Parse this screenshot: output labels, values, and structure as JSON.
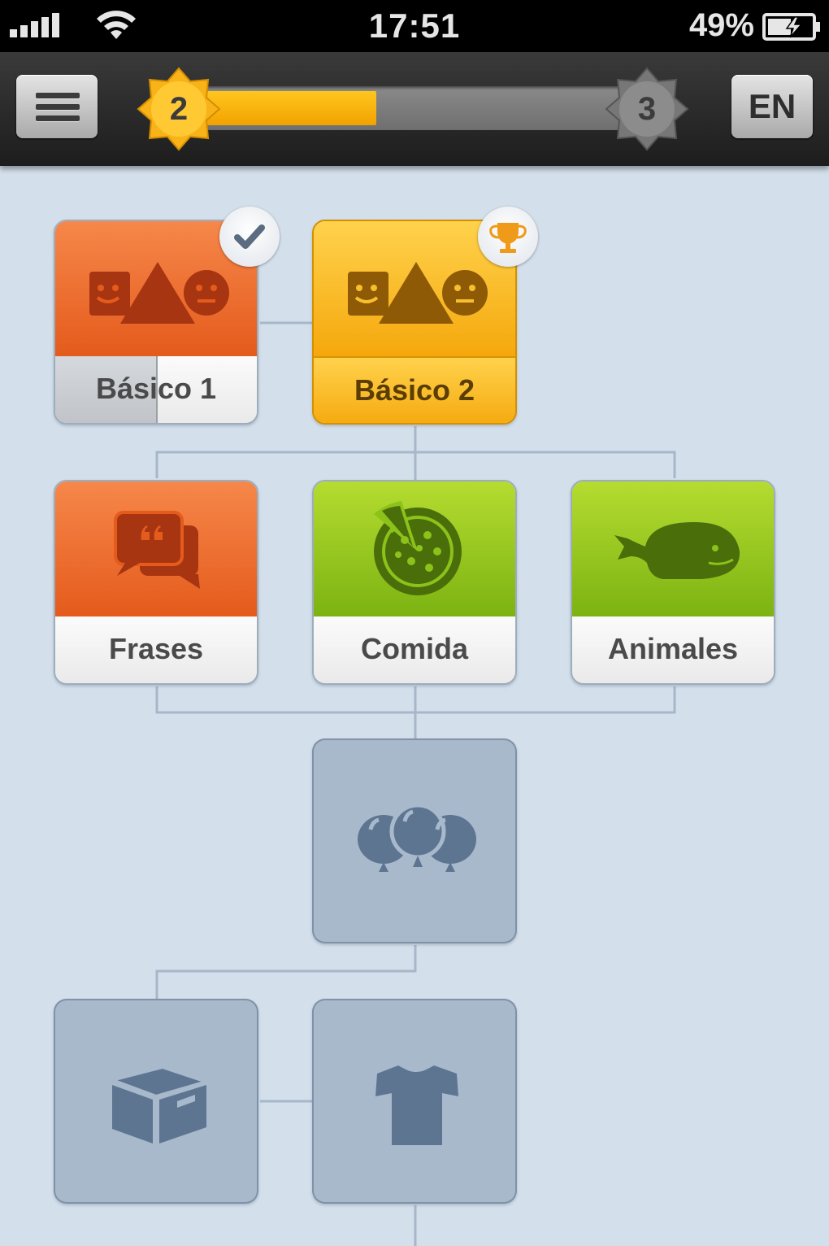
{
  "status_bar": {
    "time": "17:51",
    "battery": "49%",
    "icons": [
      "signal-icon",
      "wifi-icon",
      "battery-icon"
    ]
  },
  "toolbar": {
    "menu_icon": "hamburger-menu-icon",
    "current_level": "2",
    "next_level": "3",
    "level_progress_fraction": 0.42,
    "language": "EN"
  },
  "colors": {
    "orange": "#e9652a",
    "gold": "#f7b318",
    "green": "#8fc31e",
    "locked": "#a8b9cc",
    "background": "#d3dfeb"
  },
  "skills": [
    {
      "id": "basics-1",
      "label": "Básico 1",
      "state": "completed",
      "color": "orange",
      "icon": "shapes-faces-icon",
      "badge": "checkmark-icon",
      "strength_fraction": 0.5
    },
    {
      "id": "basics-2",
      "label": "Básico 2",
      "state": "gold",
      "color": "gold",
      "icon": "shapes-faces-icon",
      "badge": "trophy-icon"
    },
    {
      "id": "phrases",
      "label": "Frases",
      "state": "unlocked",
      "color": "orange",
      "icon": "speech-bubbles-icon"
    },
    {
      "id": "food",
      "label": "Comida",
      "state": "unlocked",
      "color": "green",
      "icon": "pizza-icon"
    },
    {
      "id": "animals",
      "label": "Animales",
      "state": "unlocked",
      "color": "green",
      "icon": "whale-icon"
    },
    {
      "id": "celebration",
      "label": "",
      "state": "locked",
      "icon": "balloons-icon"
    },
    {
      "id": "objects",
      "label": "",
      "state": "locked",
      "icon": "box-icon"
    },
    {
      "id": "clothing",
      "label": "",
      "state": "locked",
      "icon": "tshirt-icon"
    }
  ]
}
